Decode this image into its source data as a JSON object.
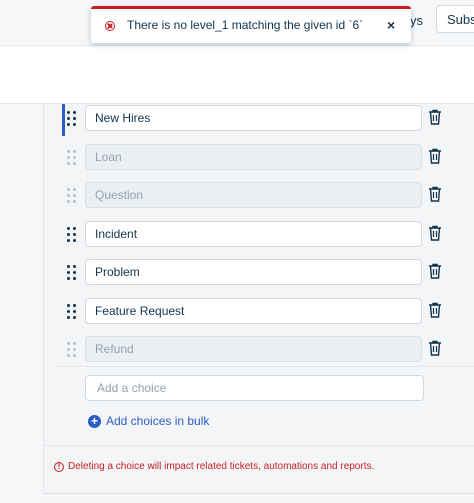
{
  "header": {
    "partial_link": "ys",
    "subscribe_button": "Subs"
  },
  "toast": {
    "message": "There is no level_1 matching the given id `6`",
    "close_label": "×",
    "icon": "error-circle-x-icon",
    "accent_color": "#c82124"
  },
  "choices": [
    {
      "label": "New Hires",
      "disabled": false,
      "active": true
    },
    {
      "label": "Loan",
      "disabled": true
    },
    {
      "label": "Question",
      "disabled": true
    },
    {
      "label": "Incident",
      "disabled": false
    },
    {
      "label": "Problem",
      "disabled": false
    },
    {
      "label": "Feature Request",
      "disabled": false
    },
    {
      "label": "Refund",
      "disabled": true
    }
  ],
  "add_choice": {
    "placeholder": "Add a choice"
  },
  "bulk_add": {
    "label": "Add choices in bulk",
    "icon": "plus-circle-icon",
    "color": "#2c5cc5"
  },
  "warning": {
    "icon": "info-circle-icon",
    "text": "Deleting a choice will impact related tickets, automations and reports.",
    "color": "#c82124"
  }
}
